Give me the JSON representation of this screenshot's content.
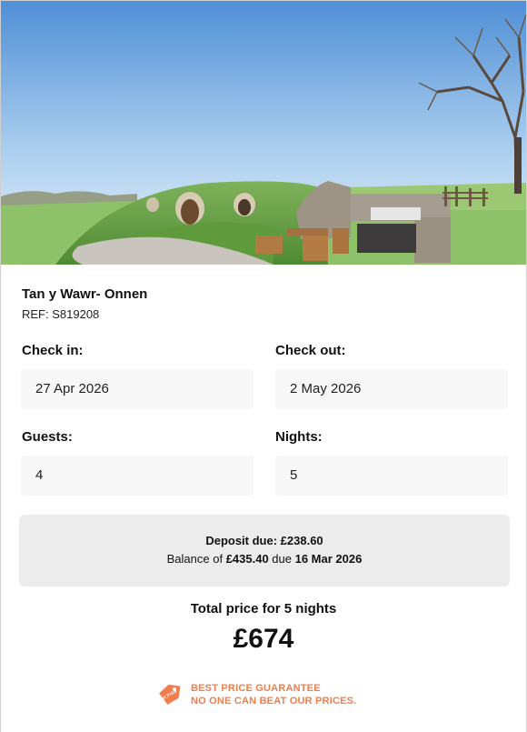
{
  "property": {
    "name": "Tan y Wawr- Onnen",
    "ref": "REF: S819208"
  },
  "booking": {
    "check_in_label": "Check in:",
    "check_in_value": "27 Apr 2026",
    "check_out_label": "Check out:",
    "check_out_value": "2 May 2026",
    "guests_label": "Guests:",
    "guests_value": "4",
    "nights_label": "Nights:",
    "nights_value": "5"
  },
  "payment": {
    "deposit_prefix": "Deposit due: ",
    "deposit_amount": "£238.60",
    "balance_prefix": "Balance of ",
    "balance_amount": "£435.40",
    "balance_mid": " due ",
    "balance_date": "16 Mar 2026"
  },
  "total": {
    "label": "Total price for 5 nights",
    "price": "£674"
  },
  "guarantee": {
    "line1": "BEST PRICE GUARANTEE",
    "line2": "NO ONE CAN BEAT OUR PRICES.",
    "badge_text": "Best Price",
    "color": "#f07d4b",
    "icon": "price-tag-icon"
  }
}
